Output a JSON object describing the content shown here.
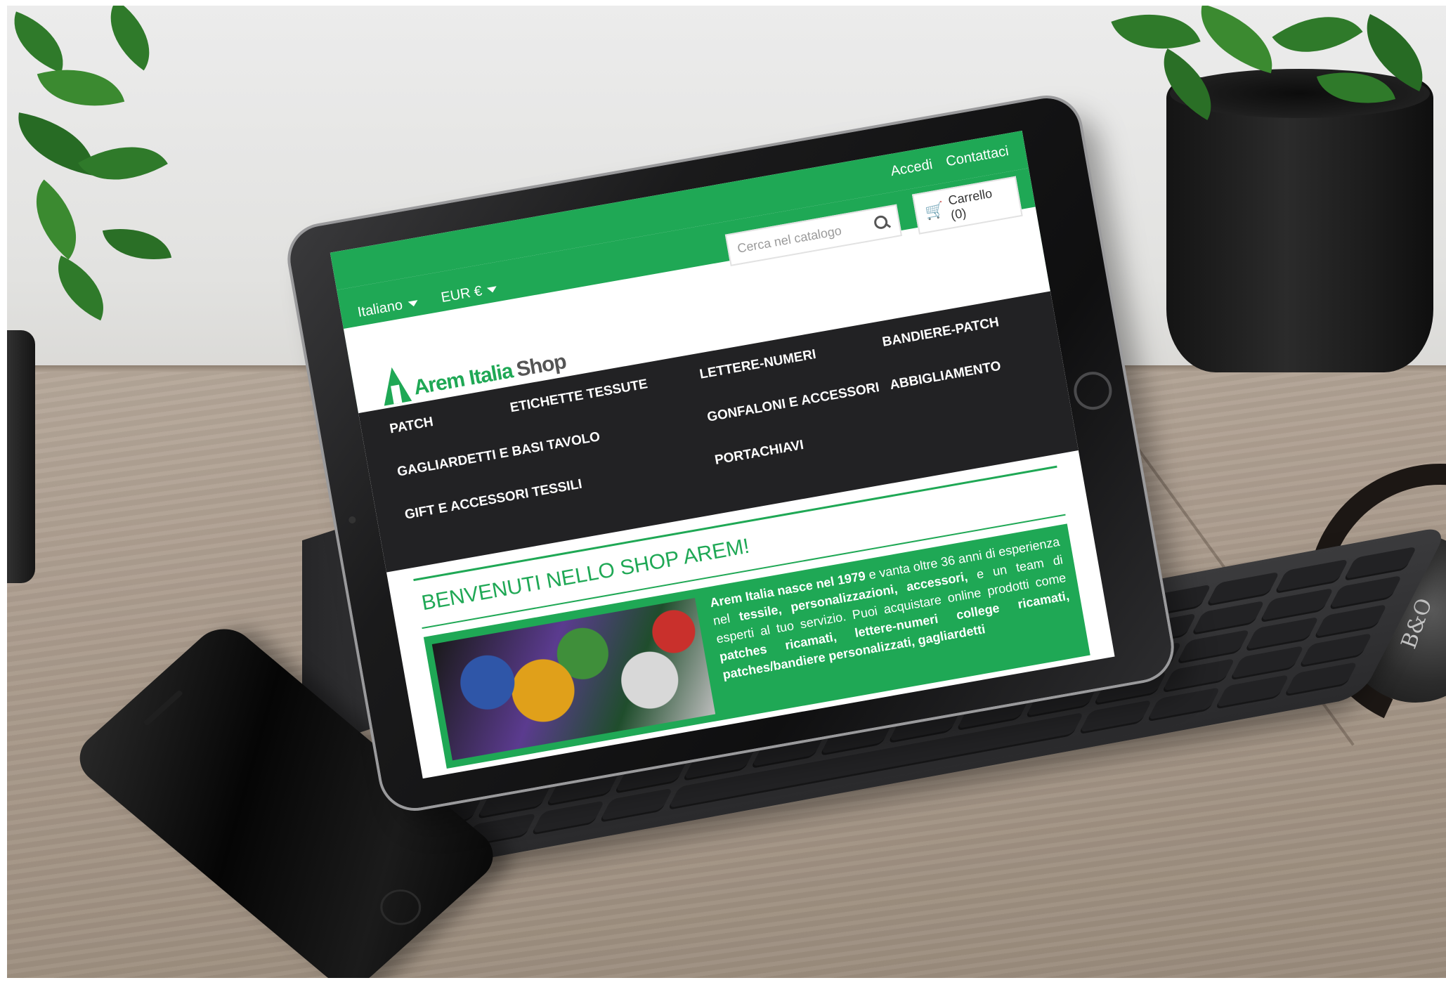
{
  "topbar": {
    "login": "Accedi",
    "contact": "Contattaci"
  },
  "selectors": {
    "language": "Italiano",
    "currency": "EUR €"
  },
  "search": {
    "placeholder": "Cerca nel catalogo"
  },
  "cart": {
    "label": "Carrello (0)"
  },
  "logo": {
    "name": "Arem Italia",
    "suffix": "Shop"
  },
  "nav": {
    "items": [
      "PATCH",
      "ETICHETTE TESSUTE",
      "LETTERE-NUMERI",
      "BANDIERE-PATCH",
      "GAGLIARDETTI E BASI TAVOLO",
      "GONFALONI E ACCESSORI",
      "ABBIGLIAMENTO",
      "GIFT E ACCESSORI TESSILI",
      "PORTACHIAVI"
    ]
  },
  "welcome": {
    "title": "BENVENUTI NELLO SHOP AREM!",
    "intro_bold": "Arem Italia nasce nel 1979",
    "intro_rest": " e vanta oltre 36 anni di esperienza nel ",
    "specialties": "tessile, personalizzazioni, accessori,",
    "team": " e un team di esperti al tuo servizio.",
    "buy": "Puoi acquistare online prodotti come ",
    "products": "patches ricamati, lettere-numeri college ricamati, patches/bandiere personalizzati, gagliardetti"
  },
  "headphones": {
    "brand": "B&O"
  },
  "colors": {
    "brand_green": "#1fa855",
    "nav_dark": "#222224"
  }
}
